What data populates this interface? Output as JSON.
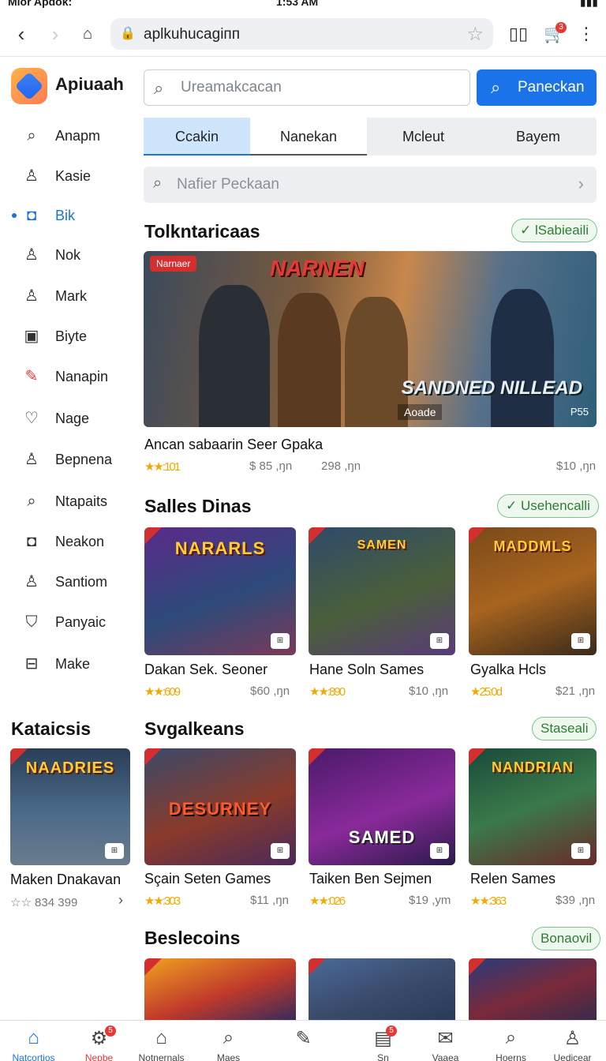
{
  "status": {
    "left": "Mior Apdok:",
    "time": "1:53 AM"
  },
  "browser": {
    "url": "aplkuhucagiпп",
    "cart_count": "3"
  },
  "app": {
    "name": "Apiuaah"
  },
  "sidebar": {
    "items": [
      {
        "label": "Anapm",
        "icon": "search-icon"
      },
      {
        "label": "Kasie",
        "icon": "user-icon"
      },
      {
        "label": "Bik",
        "icon": "square-icon",
        "active": true
      },
      {
        "label": "Nok",
        "icon": "user-icon"
      },
      {
        "label": "Mark",
        "icon": "user-icon"
      },
      {
        "label": "Biyte",
        "icon": "frame-icon"
      },
      {
        "label": "Nanapin",
        "icon": "pencil-icon"
      },
      {
        "label": "Nage",
        "icon": "heart-icon"
      },
      {
        "label": "Bepnena",
        "icon": "user-icon"
      },
      {
        "label": "Ntapaits",
        "icon": "search-icon"
      },
      {
        "label": "Neakon",
        "icon": "square-icon"
      },
      {
        "label": "Santiom",
        "icon": "user-icon"
      },
      {
        "label": "Panyaic",
        "icon": "bookmark-icon"
      },
      {
        "label": "Make",
        "icon": "box-icon"
      }
    ],
    "section_title": "Kataicsis"
  },
  "search": {
    "placeholder": "Ureamakcacan",
    "button_label": "Paneckan"
  },
  "tabs": [
    "Ccakin",
    "Nanekan",
    "Mcleut",
    "Bayem"
  ],
  "filter": {
    "placeholder": "Nafier Peckaan"
  },
  "featured": {
    "title": "Tolkntaricaas",
    "pill": "lSabieaili",
    "tag": "Narnaer",
    "banner_title": "NARNEN",
    "banner_logo": "SANDNED NILLEAD",
    "platform": "Aoade",
    "ps": "P55",
    "name": "Ancan sabaarin Seer Gpaka",
    "rating": "★★:101",
    "price1": "$ 85 ,ŋn",
    "price2": "298 ,ŋn",
    "price3": "$10 ,ŋn"
  },
  "sales": {
    "title": "Salles Dinas",
    "pill": "Usehencalli",
    "items": [
      {
        "banner": "NARARLS",
        "name": "Dakan Sek. Seoner",
        "rating": "★★:609",
        "price": "$60 ,ŋn"
      },
      {
        "banner": "SAMEN",
        "name": "Hane Soln Sames",
        "rating": "★★:890",
        "price": "$10 ,ŋn"
      },
      {
        "banner": "MADDMLS",
        "name": "Gyalka Hcls",
        "rating": "★25:0d",
        "price": "$21 ,ŋn"
      }
    ]
  },
  "side_game": {
    "banner": "NAADRIES",
    "name": "Maken Dnakavan",
    "rating": "☆☆ 834 399"
  },
  "svgalkeans": {
    "title": "Svgalkeans",
    "pill": "Staseali",
    "items": [
      {
        "banner": "DESURNEY",
        "name": "Sçain Seten Games",
        "rating": "★★:303",
        "price": "$11 ,ŋn"
      },
      {
        "banner": "SAMED",
        "name": "Taiken Ben Sejmen",
        "rating": "★★:026",
        "price": "$19 ,ym"
      },
      {
        "banner": "NANDRIAN",
        "name": "Relen Sames",
        "rating": "★★:363",
        "price": "$39 ,ŋn"
      }
    ]
  },
  "beslecoins": {
    "title": "Beslecoins",
    "pill": "Bonaovil"
  },
  "bottom_nav": [
    {
      "label": "Natcortios",
      "icon": "home-icon",
      "active": true
    },
    {
      "label": "Nepbe",
      "icon": "gear-icon",
      "badge": "5"
    },
    {
      "label": "Notnernals",
      "icon": "house-icon"
    },
    {
      "label": "Maes",
      "icon": "search-icon"
    },
    {
      "label": "",
      "icon": "edit-icon"
    },
    {
      "label": "Sn",
      "icon": "inbox-icon",
      "badge": "5"
    },
    {
      "label": "Vaaea",
      "icon": "mail-icon"
    },
    {
      "label": "Hoerns",
      "icon": "search-icon"
    },
    {
      "label": "Uedicear",
      "icon": "user-icon"
    }
  ]
}
